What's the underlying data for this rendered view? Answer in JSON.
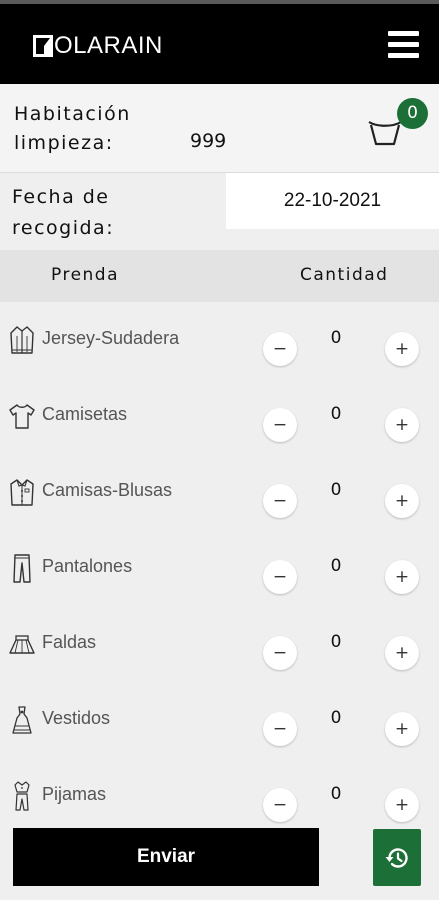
{
  "app": {
    "logo_text": "OLARAIN",
    "menu_icon": "hamburger-icon"
  },
  "room": {
    "label": "Habitación limpieza:",
    "value": "999"
  },
  "cart": {
    "icon": "laundry-basket-icon",
    "badge_count": "0",
    "badge_color": "#1d6f38"
  },
  "pickup": {
    "label": "Fecha de recogida:",
    "date_value": "22-10-2021"
  },
  "table": {
    "col_item": "Prenda",
    "col_quantity": "Cantidad"
  },
  "items": [
    {
      "name": "Jersey-Sudadera",
      "icon": "sweater-icon",
      "quantity": "0",
      "minus": "−",
      "plus": "+"
    },
    {
      "name": "Camisetas",
      "icon": "tshirt-icon",
      "quantity": "0",
      "minus": "−",
      "plus": "+"
    },
    {
      "name": "Camisas-Blusas",
      "icon": "shirt-icon",
      "quantity": "0",
      "minus": "−",
      "plus": "+"
    },
    {
      "name": "Pantalones",
      "icon": "trousers-icon",
      "quantity": "0",
      "minus": "−",
      "plus": "+"
    },
    {
      "name": "Faldas",
      "icon": "skirt-icon",
      "quantity": "0",
      "minus": "−",
      "plus": "+"
    },
    {
      "name": "Vestidos",
      "icon": "dress-icon",
      "quantity": "0",
      "minus": "−",
      "plus": "+"
    },
    {
      "name": "Pijamas",
      "icon": "pajamas-icon",
      "quantity": "0",
      "minus": "−",
      "plus": "+"
    }
  ],
  "actions": {
    "send_label": "Enviar",
    "history_icon": "history-icon",
    "history_color": "#1d6f38"
  }
}
